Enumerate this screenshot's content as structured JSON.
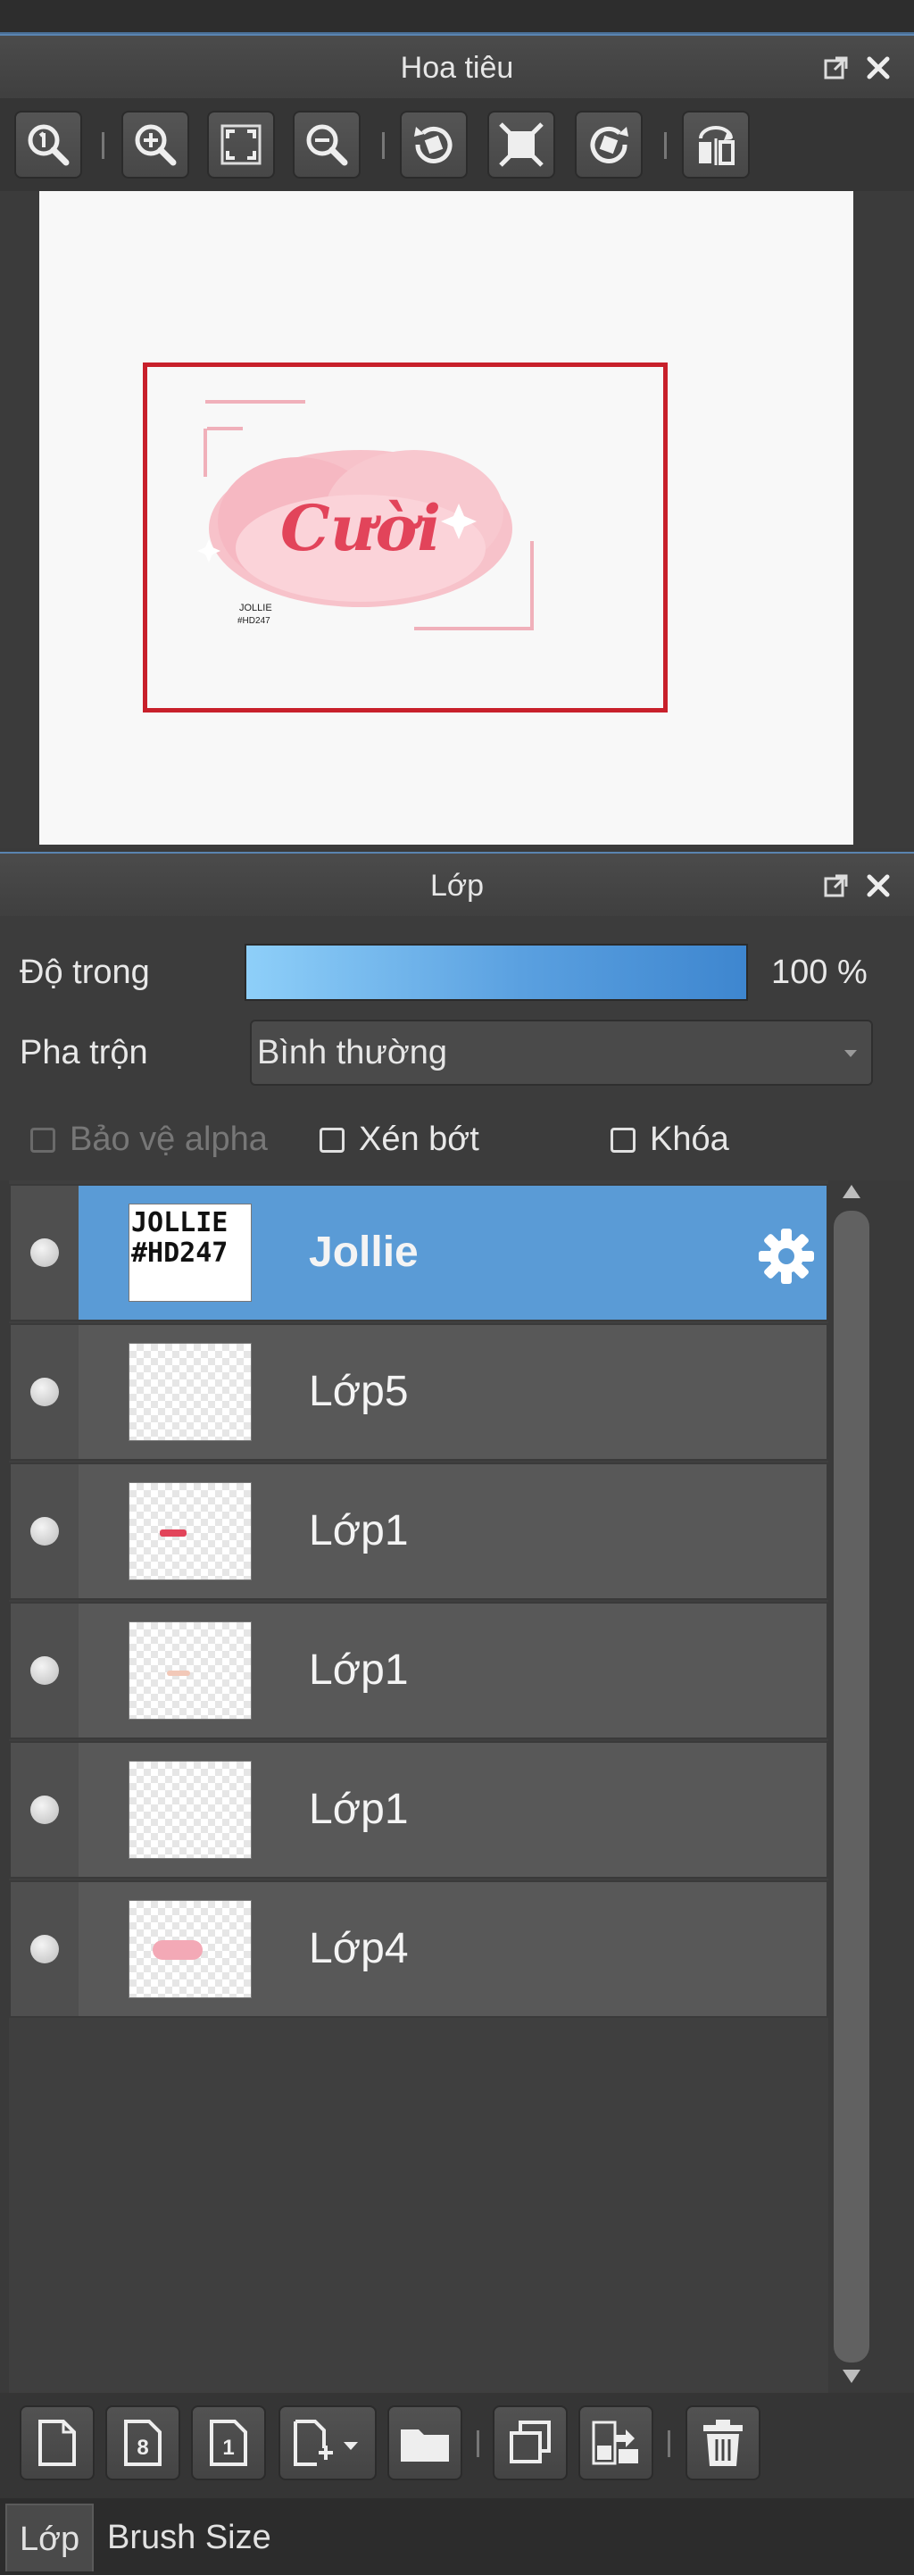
{
  "navigator": {
    "title": "Hoa tiêu",
    "toolbar": [
      "zoom-actual-size",
      "zoom-in",
      "fit-to-window",
      "zoom-out",
      "rotate-left",
      "reset-rotation",
      "rotate-right",
      "flip-horizontal"
    ],
    "preview": {
      "title_art": "Cười",
      "signature_line1": "JOLLIE",
      "signature_line2": "#HD247"
    }
  },
  "layers_panel": {
    "title": "Lớp",
    "opacity_label": "Độ trong",
    "opacity_value": "100 %",
    "opacity_fraction": 1.0,
    "blend_label": "Pha trộn",
    "blend_value": "Bình thường",
    "protect_alpha_label": "Bảo vệ alpha",
    "clipping_label": "Xén bớt",
    "lock_label": "Khóa",
    "layers": [
      {
        "name": "Jollie",
        "thumb_line1": "JOLLIE",
        "thumb_line2": "#HD247",
        "selected": true
      },
      {
        "name": "Lớp5",
        "selected": false
      },
      {
        "name": "Lớp1",
        "selected": false
      },
      {
        "name": "Lớp1",
        "selected": false
      },
      {
        "name": "Lớp1",
        "selected": false
      },
      {
        "name": "Lớp4",
        "selected": false
      }
    ],
    "toolbar": [
      "new-layer",
      "new-halftone-layer",
      "new-1bit-layer",
      "add-layer-menu",
      "new-folder",
      "duplicate-layer",
      "merge-down",
      "delete-layer"
    ]
  },
  "tabs": [
    {
      "label": "Lớp",
      "active": true
    },
    {
      "label": "Brush Size",
      "active": false
    }
  ],
  "colors": {
    "selection_blue": "#5a9bd6",
    "viewport_red": "#c8202b",
    "opacity_bar": "#5aa0e0",
    "panel_bg": "#3a3a3a"
  }
}
